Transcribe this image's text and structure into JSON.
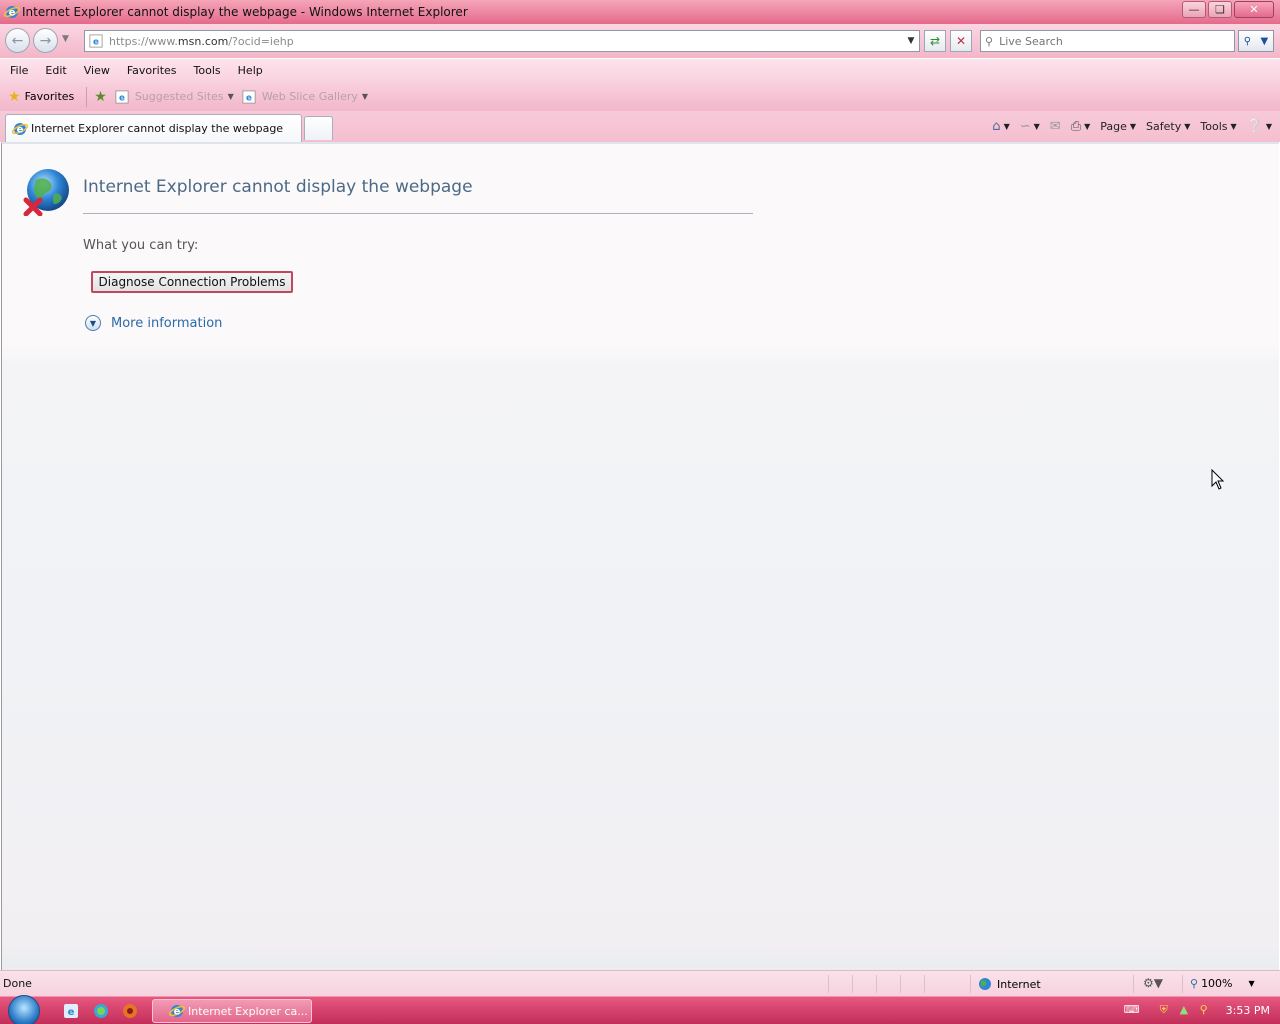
{
  "window": {
    "title": "Internet Explorer cannot display the webpage - Windows Internet Explorer",
    "controls": [
      "minimize",
      "restore",
      "close"
    ]
  },
  "address_bar": {
    "url_prefix": "https://www.",
    "url_domain": "msn.com",
    "url_suffix": "/?ocid=iehp"
  },
  "search": {
    "placeholder": "Live Search"
  },
  "menu": {
    "items": [
      "File",
      "Edit",
      "View",
      "Favorites",
      "Tools",
      "Help"
    ]
  },
  "favorites_bar": {
    "favorites_label": "Favorites",
    "suggested_sites": "Suggested Sites",
    "web_slice_gallery": "Web Slice Gallery"
  },
  "tabs": {
    "active_label": "Internet Explorer cannot display the webpage"
  },
  "command_bar": {
    "page": "Page",
    "safety": "Safety",
    "tools": "Tools"
  },
  "content": {
    "heading": "Internet Explorer cannot display the webpage",
    "try_label": "What you can try:",
    "diagnose_button": "Diagnose Connection Problems",
    "more_info": "More information"
  },
  "status_bar": {
    "status": "Done",
    "zone": "Internet",
    "zoom": "100%"
  },
  "taskbar": {
    "task_label": "Internet Explorer ca...",
    "clock": "3:53 PM"
  },
  "colors": {
    "titlebar_accent": "#e46a8c",
    "taskbar": "#c22e59",
    "heading_text": "#4c6a86",
    "link": "#2b6aa8",
    "button_border": "#c0475e"
  }
}
